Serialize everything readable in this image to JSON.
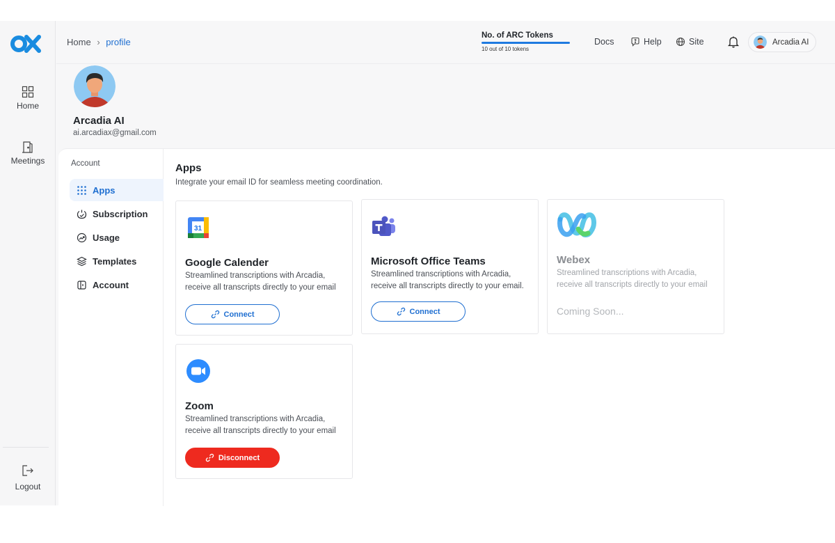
{
  "sidebar": {
    "items": [
      {
        "label": "Home",
        "icon": "grid-icon"
      },
      {
        "label": "Meetings",
        "icon": "door-icon"
      }
    ],
    "logout": {
      "label": "Logout",
      "icon": "logout-icon"
    }
  },
  "header": {
    "breadcrumb": {
      "home": "Home",
      "separator": "›",
      "current": "profile"
    },
    "tokens": {
      "title": "No. of ARC Tokens",
      "detail": "10 out of 10 tokens",
      "progress": 1.0
    },
    "links": [
      {
        "label": "Docs"
      },
      {
        "label": "Help",
        "icon": "help-icon"
      },
      {
        "label": "Site",
        "icon": "globe-icon"
      }
    ],
    "user": {
      "name": "Arcadia AI"
    }
  },
  "profile": {
    "name": "Arcadia AI",
    "email": "ai.arcadiax@gmail.com"
  },
  "subnav": {
    "section": "Account",
    "items": [
      {
        "label": "Apps",
        "icon": "apps-grid-icon",
        "active": true
      },
      {
        "label": "Subscription",
        "icon": "subscription-icon"
      },
      {
        "label": "Usage",
        "icon": "usage-icon"
      },
      {
        "label": "Templates",
        "icon": "templates-icon"
      },
      {
        "label": "Account",
        "icon": "account-icon"
      }
    ]
  },
  "main": {
    "title": "Apps",
    "subtitle": "Integrate your email ID for seamless meeting coordination.",
    "apps": [
      {
        "name": "Google Calender",
        "desc": "Streamlined transcriptions with Arcadia, receive all transcripts directly to your email",
        "action": "Connect",
        "icon_text": "31"
      },
      {
        "name": "Microsoft Office Teams",
        "desc": "Streamlined transcriptions with Arcadia, receive all transcripts directly to your email.",
        "action": "Connect"
      },
      {
        "name": "Webex",
        "desc": "Streamlined transcriptions with Arcadia, receive all transcripts directly to your email",
        "status": "Coming Soon..."
      },
      {
        "name": "Zoom",
        "desc": "Streamlined transcriptions with Arcadia, receive all transcripts directly to your email",
        "action": "Disconnect"
      }
    ]
  },
  "colors": {
    "accent": "#1f6fd1",
    "danger": "#ee2a1f",
    "logo": "#1a8ce0"
  }
}
